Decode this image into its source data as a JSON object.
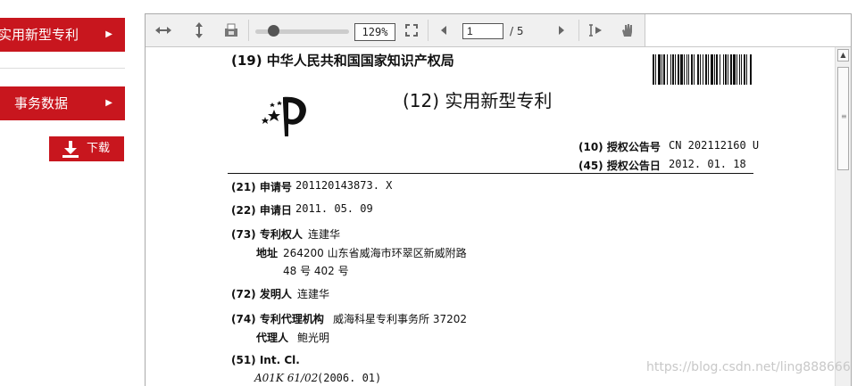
{
  "sidebar": {
    "items": [
      {
        "label": "实用新型专利",
        "chevron": "▶"
      },
      {
        "label": "事务数据",
        "chevron": "▶"
      }
    ],
    "download_label": "下载"
  },
  "toolbar": {
    "zoom": "129%",
    "page_current": "1",
    "page_total": "/ 5",
    "icons": [
      "fit-width-icon",
      "fit-height-icon",
      "print-icon",
      "fullscreen-icon",
      "prev-page-icon",
      "next-page-icon",
      "text-select-icon",
      "hand-tool-icon"
    ]
  },
  "document": {
    "office": "(19) 中华人民共和国国家知识产权局",
    "doc_type": "(12) 实用新型专利",
    "grant_no_label": "(10) 授权公告号",
    "grant_no": "CN 202112160 U",
    "grant_date_label": "(45) 授权公告日",
    "grant_date": "2012. 01. 18",
    "app_no_label": "(21) 申请号",
    "app_no": "201120143873. X",
    "app_date_label": "(22) 申请日",
    "app_date": "2011. 05. 09",
    "patentee_label": "(73) 专利权人",
    "patentee": "连建华",
    "address_label": "地址",
    "address_line1": "264200  山东省威海市环翠区新威附路",
    "address_line2": "48 号 402 号",
    "inventor_label": "(72) 发明人",
    "inventor": "连建华",
    "agency_label": "(74) 专利代理机构",
    "agency": "威海科星专利事务所  37202",
    "agent_label": "代理人",
    "agent": "鲍光明",
    "intcl_label": "(51) Int. Cl.",
    "intcl_code": "A01K 61/02",
    "intcl_year": "(2006. 01)"
  },
  "watermark": "https://blog.csdn.net/ling888666",
  "colors": {
    "brand_red": "#c8161e"
  }
}
